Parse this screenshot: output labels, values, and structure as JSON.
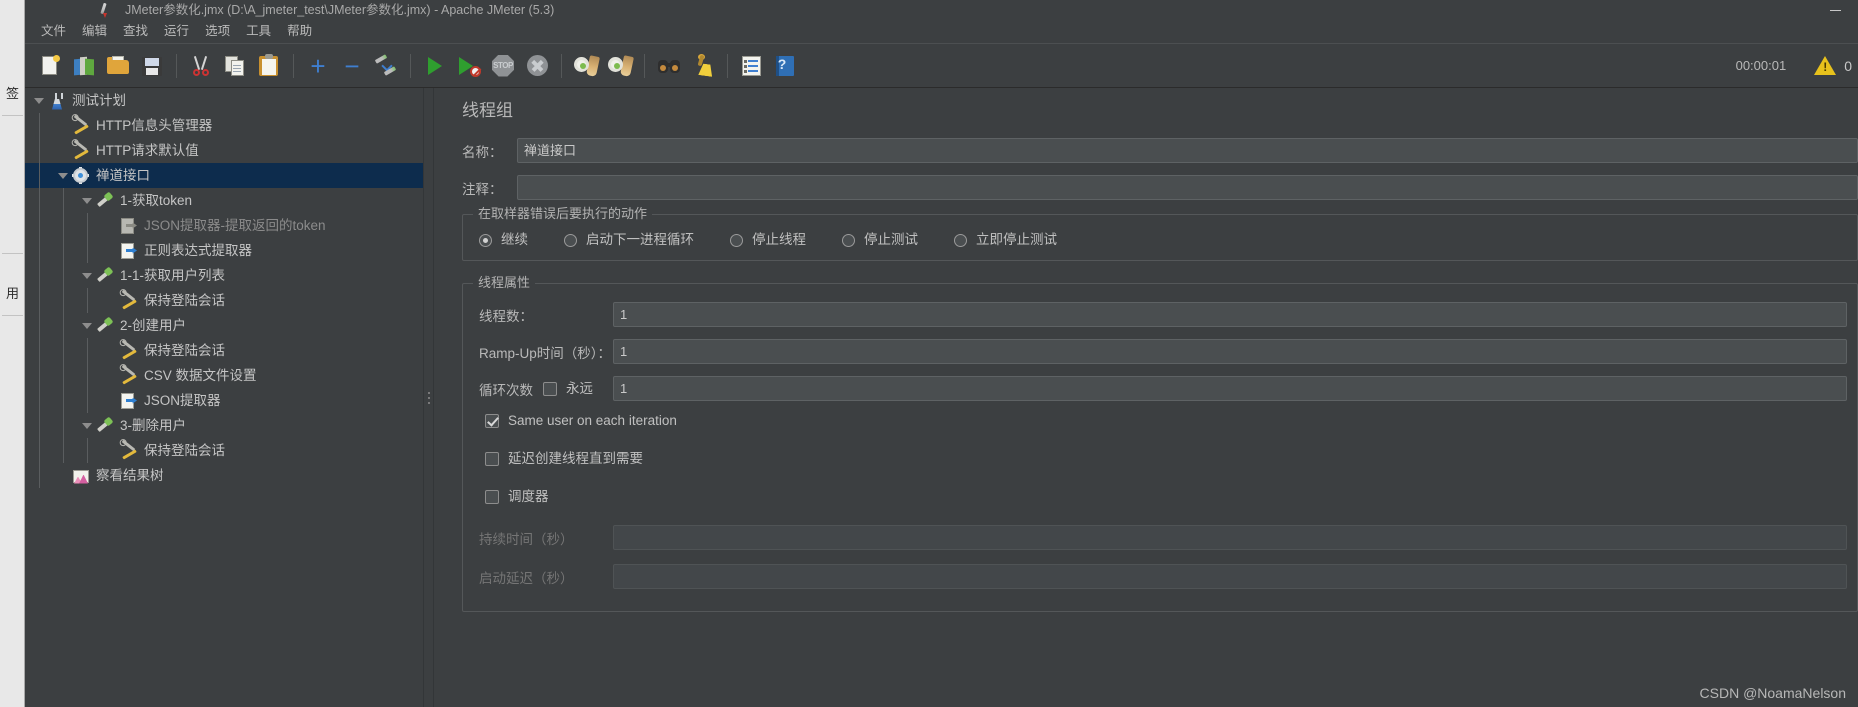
{
  "window": {
    "title": "JMeter参数化.jmx (D:\\A_jmeter_test\\JMeter参数化.jmx) - Apache JMeter (5.3)",
    "app_icon": "jmeter-feather-icon",
    "minimize_label": "—"
  },
  "side_strip": {
    "tabs": [
      {
        "label": "签",
        "name": "side-tab-bookmark"
      },
      {
        "label": "用",
        "name": "side-tab-usage"
      }
    ]
  },
  "menubar": {
    "items": [
      {
        "label": "文件",
        "name": "menu-file"
      },
      {
        "label": "编辑",
        "name": "menu-edit"
      },
      {
        "label": "查找",
        "name": "menu-search"
      },
      {
        "label": "运行",
        "name": "menu-run"
      },
      {
        "label": "选项",
        "name": "menu-options"
      },
      {
        "label": "工具",
        "name": "menu-tools"
      },
      {
        "label": "帮助",
        "name": "menu-help"
      }
    ]
  },
  "toolbar": {
    "buttons": [
      {
        "icon": "new-document-icon",
        "name": "toolbar-new"
      },
      {
        "icon": "templates-icon",
        "name": "toolbar-templates"
      },
      {
        "icon": "open-folder-icon",
        "name": "toolbar-open"
      },
      {
        "icon": "save-floppy-icon",
        "name": "toolbar-save"
      },
      {
        "icon": "scissors-icon",
        "name": "toolbar-cut"
      },
      {
        "icon": "copy-icon",
        "name": "toolbar-copy"
      },
      {
        "icon": "paste-icon",
        "name": "toolbar-paste"
      },
      {
        "icon": "plus-icon",
        "name": "toolbar-expand-all"
      },
      {
        "icon": "minus-icon",
        "name": "toolbar-collapse-all"
      },
      {
        "icon": "toggle-pencils-icon",
        "name": "toolbar-toggle"
      },
      {
        "icon": "play-icon",
        "name": "toolbar-start"
      },
      {
        "icon": "play-no-timers-icon",
        "name": "toolbar-start-no-pauses"
      },
      {
        "icon": "stop-icon",
        "name": "toolbar-stop"
      },
      {
        "icon": "shutdown-icon",
        "name": "toolbar-shutdown"
      },
      {
        "icon": "clear-gear-icon",
        "name": "toolbar-clear"
      },
      {
        "icon": "clear-all-gear-icon",
        "name": "toolbar-clear-all"
      },
      {
        "icon": "binoculars-icon",
        "name": "toolbar-search"
      },
      {
        "icon": "broom-icon",
        "name": "toolbar-reset-search"
      },
      {
        "icon": "function-helper-icon",
        "name": "toolbar-function-helper"
      },
      {
        "icon": "help-book-icon",
        "name": "toolbar-help"
      }
    ],
    "stop_glyph": "STOP",
    "timer": "00:00:01",
    "warning_icon": "warning-triangle-icon",
    "warning_count": "0"
  },
  "tree": {
    "nodes": [
      {
        "label": "测试计划",
        "icon": "test-plan-icon",
        "depth": 0,
        "twisty": "open",
        "selected": false,
        "dim": false
      },
      {
        "label": "HTTP信息头管理器",
        "icon": "config-wrench-icon",
        "depth": 1,
        "twisty": "none",
        "selected": false,
        "dim": false
      },
      {
        "label": "HTTP请求默认值",
        "icon": "config-wrench-icon",
        "depth": 1,
        "twisty": "none",
        "selected": false,
        "dim": false
      },
      {
        "label": "禅道接口",
        "icon": "thread-group-gear-icon",
        "depth": 1,
        "twisty": "open",
        "selected": true,
        "dim": false
      },
      {
        "label": "1-获取token",
        "icon": "sampler-pipette-icon",
        "depth": 2,
        "twisty": "open",
        "selected": false,
        "dim": false
      },
      {
        "label": "JSON提取器-提取返回的token",
        "icon": "post-processor-icon",
        "depth": 3,
        "twisty": "none",
        "selected": false,
        "dim": true
      },
      {
        "label": "正则表达式提取器",
        "icon": "post-processor-icon",
        "depth": 3,
        "twisty": "none",
        "selected": false,
        "dim": false
      },
      {
        "label": "1-1-获取用户列表",
        "icon": "sampler-pipette-icon",
        "depth": 2,
        "twisty": "open",
        "selected": false,
        "dim": false
      },
      {
        "label": "保持登陆会话",
        "icon": "config-wrench-icon",
        "depth": 3,
        "twisty": "none",
        "selected": false,
        "dim": false
      },
      {
        "label": "2-创建用户",
        "icon": "sampler-pipette-icon",
        "depth": 2,
        "twisty": "open",
        "selected": false,
        "dim": false
      },
      {
        "label": "保持登陆会话",
        "icon": "config-wrench-icon",
        "depth": 3,
        "twisty": "none",
        "selected": false,
        "dim": false
      },
      {
        "label": "CSV 数据文件设置",
        "icon": "config-wrench-icon",
        "depth": 3,
        "twisty": "none",
        "selected": false,
        "dim": false
      },
      {
        "label": "JSON提取器",
        "icon": "post-processor-icon",
        "depth": 3,
        "twisty": "none",
        "selected": false,
        "dim": false
      },
      {
        "label": "3-删除用户",
        "icon": "sampler-pipette-icon",
        "depth": 2,
        "twisty": "open",
        "selected": false,
        "dim": false
      },
      {
        "label": "保持登陆会话",
        "icon": "config-wrench-icon",
        "depth": 3,
        "twisty": "none",
        "selected": false,
        "dim": false
      },
      {
        "label": "察看结果树",
        "icon": "view-results-tree-icon",
        "depth": 1,
        "twisty": "none",
        "selected": false,
        "dim": false
      }
    ]
  },
  "config": {
    "title": "线程组",
    "name_label": "名称：",
    "name_value": "禅道接口",
    "comment_label": "注释：",
    "comment_value": "",
    "comment_placeholder": "",
    "error_action": {
      "group_title": "在取样器错误后要执行的动作",
      "options": [
        {
          "label": "继续",
          "checked": true
        },
        {
          "label": "启动下一进程循环",
          "checked": false
        },
        {
          "label": "停止线程",
          "checked": false
        },
        {
          "label": "停止测试",
          "checked": false
        },
        {
          "label": "立即停止测试",
          "checked": false
        }
      ]
    },
    "thread_props": {
      "group_title": "线程属性",
      "num_threads_label": "线程数：",
      "num_threads_value": "1",
      "rampup_label": "Ramp-Up时间（秒）：",
      "rampup_value": "1",
      "loop_label": "循环次数",
      "forever_label": "永远",
      "forever_checked": false,
      "loop_value": "1",
      "same_user_label": "Same user on each iteration",
      "same_user_checked": true,
      "delayed_start_label": "延迟创建线程直到需要",
      "delayed_start_checked": false,
      "scheduler_label": "调度器",
      "scheduler_checked": false,
      "duration_label": "持续时间（秒）",
      "duration_value": "",
      "startup_delay_label": "启动延迟（秒）",
      "startup_delay_value": ""
    }
  },
  "watermark": "CSDN @NoamaNelson",
  "colors": {
    "window_bg": "#3c3f41",
    "selection": "#0d2c4d",
    "accent_blue": "#3f7fd0",
    "text": "#c5c5c5",
    "text_dim": "#8b8b8b",
    "warning": "#e8c21c"
  }
}
